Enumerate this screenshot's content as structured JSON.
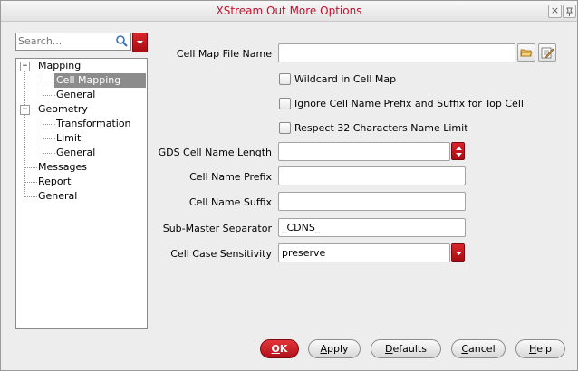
{
  "window": {
    "title": "XStream Out More Options"
  },
  "search": {
    "placeholder": "Search..."
  },
  "tree": {
    "mapping": "Mapping",
    "cell_mapping": "Cell Mapping",
    "mapping_general": "General",
    "geometry": "Geometry",
    "transformation": "Transformation",
    "limit": "Limit",
    "geometry_general": "General",
    "messages": "Messages",
    "report": "Report",
    "general": "General"
  },
  "form": {
    "cell_map_file_label": "Cell Map File Name",
    "cell_map_file_value": "",
    "wildcard_label": "Wildcard in Cell Map",
    "ignore_prefix_label": "Ignore Cell Name Prefix and Suffix for Top Cell",
    "respect32_label": "Respect 32 Characters Name Limit",
    "gds_length_label": "GDS Cell Name Length",
    "gds_length_value": "",
    "prefix_label": "Cell Name Prefix",
    "prefix_value": "",
    "suffix_label": "Cell Name Suffix",
    "suffix_value": "",
    "separator_label": "Sub-Master Separator",
    "separator_value": "_CDNS_",
    "case_label": "Cell Case Sensitivity",
    "case_value": "preserve"
  },
  "buttons": {
    "ok": {
      "u": "O",
      "rest": "K"
    },
    "apply": {
      "u": "A",
      "rest": "pply"
    },
    "defaults": {
      "u": "D",
      "rest": "efaults"
    },
    "cancel": {
      "u": "C",
      "rest": "ancel"
    },
    "help": {
      "u": "H",
      "rest": "elp"
    }
  },
  "colors": {
    "accent": "#c8102e",
    "selection": "#8c8c8c"
  }
}
